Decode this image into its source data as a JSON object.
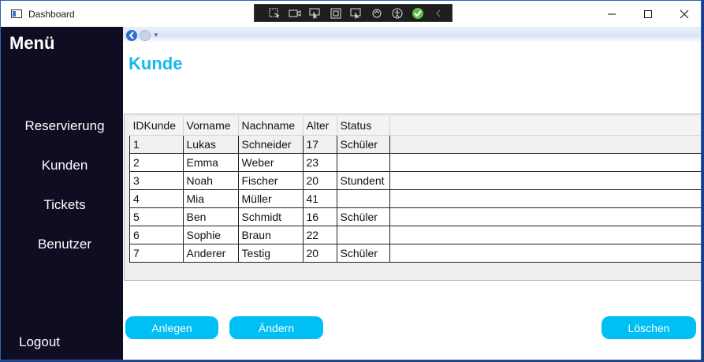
{
  "window": {
    "title": "Dashboard"
  },
  "titlebar": {
    "buttons": [
      "minimize-icon",
      "maximize-icon",
      "close-icon"
    ]
  },
  "devtools": {
    "icons": [
      "select-element-icon",
      "video-icon",
      "pointer-icon",
      "frame-icon",
      "track-focus-icon",
      "hot-reload-icon",
      "accessibility-icon",
      "check-icon",
      "collapse-icon"
    ]
  },
  "sidebar": {
    "title": "Menü",
    "items": [
      {
        "label": "Reservierung"
      },
      {
        "label": "Kunden"
      },
      {
        "label": "Tickets"
      },
      {
        "label": "Benutzer"
      }
    ],
    "logout": "Logout"
  },
  "page": {
    "title": "Kunde"
  },
  "table": {
    "columns": [
      "IDKunde",
      "Vorname",
      "Nachname",
      "Alter",
      "Status"
    ],
    "rows": [
      [
        "1",
        "Lukas",
        "Schneider",
        "17",
        "Schüler"
      ],
      [
        "2",
        "Emma",
        "Weber",
        "23",
        ""
      ],
      [
        "3",
        "Noah",
        "Fischer",
        "20",
        "Stundent"
      ],
      [
        "4",
        "Mia",
        "Müller",
        "41",
        ""
      ],
      [
        "5",
        "Ben",
        "Schmidt",
        "16",
        "Schüler"
      ],
      [
        "6",
        "Sophie",
        "Braun",
        "22",
        ""
      ],
      [
        "7",
        "Anderer",
        "Testig",
        "20",
        "Schüler"
      ]
    ]
  },
  "actions": {
    "create": "Anlegen",
    "edit": "Ändern",
    "delete": "Löschen"
  },
  "colors": {
    "sidebar": "#0f0d22",
    "accent": "#00bff5",
    "title": "#19b8ee"
  }
}
